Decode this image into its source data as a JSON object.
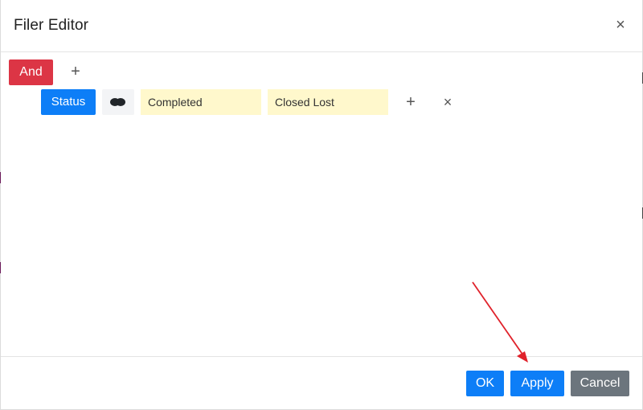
{
  "dialog": {
    "title": "Filer Editor",
    "close_glyph": "×"
  },
  "group": {
    "operator_label": "And",
    "add_glyph": "+"
  },
  "condition": {
    "field_label": "Status",
    "operator_icon": "intersect-circles-icon",
    "values": [
      "Completed",
      "Closed Lost"
    ],
    "add_glyph": "+",
    "remove_glyph": "×"
  },
  "footer": {
    "ok_label": "OK",
    "apply_label": "Apply",
    "cancel_label": "Cancel"
  },
  "colors": {
    "danger": "#dc3545",
    "primary": "#0d7ef7",
    "secondary": "#6c757d",
    "value_bg": "#fff8cc",
    "annotation_arrow": "#e0222b"
  },
  "annotation": {
    "type": "arrow",
    "points_to": "apply-button"
  }
}
